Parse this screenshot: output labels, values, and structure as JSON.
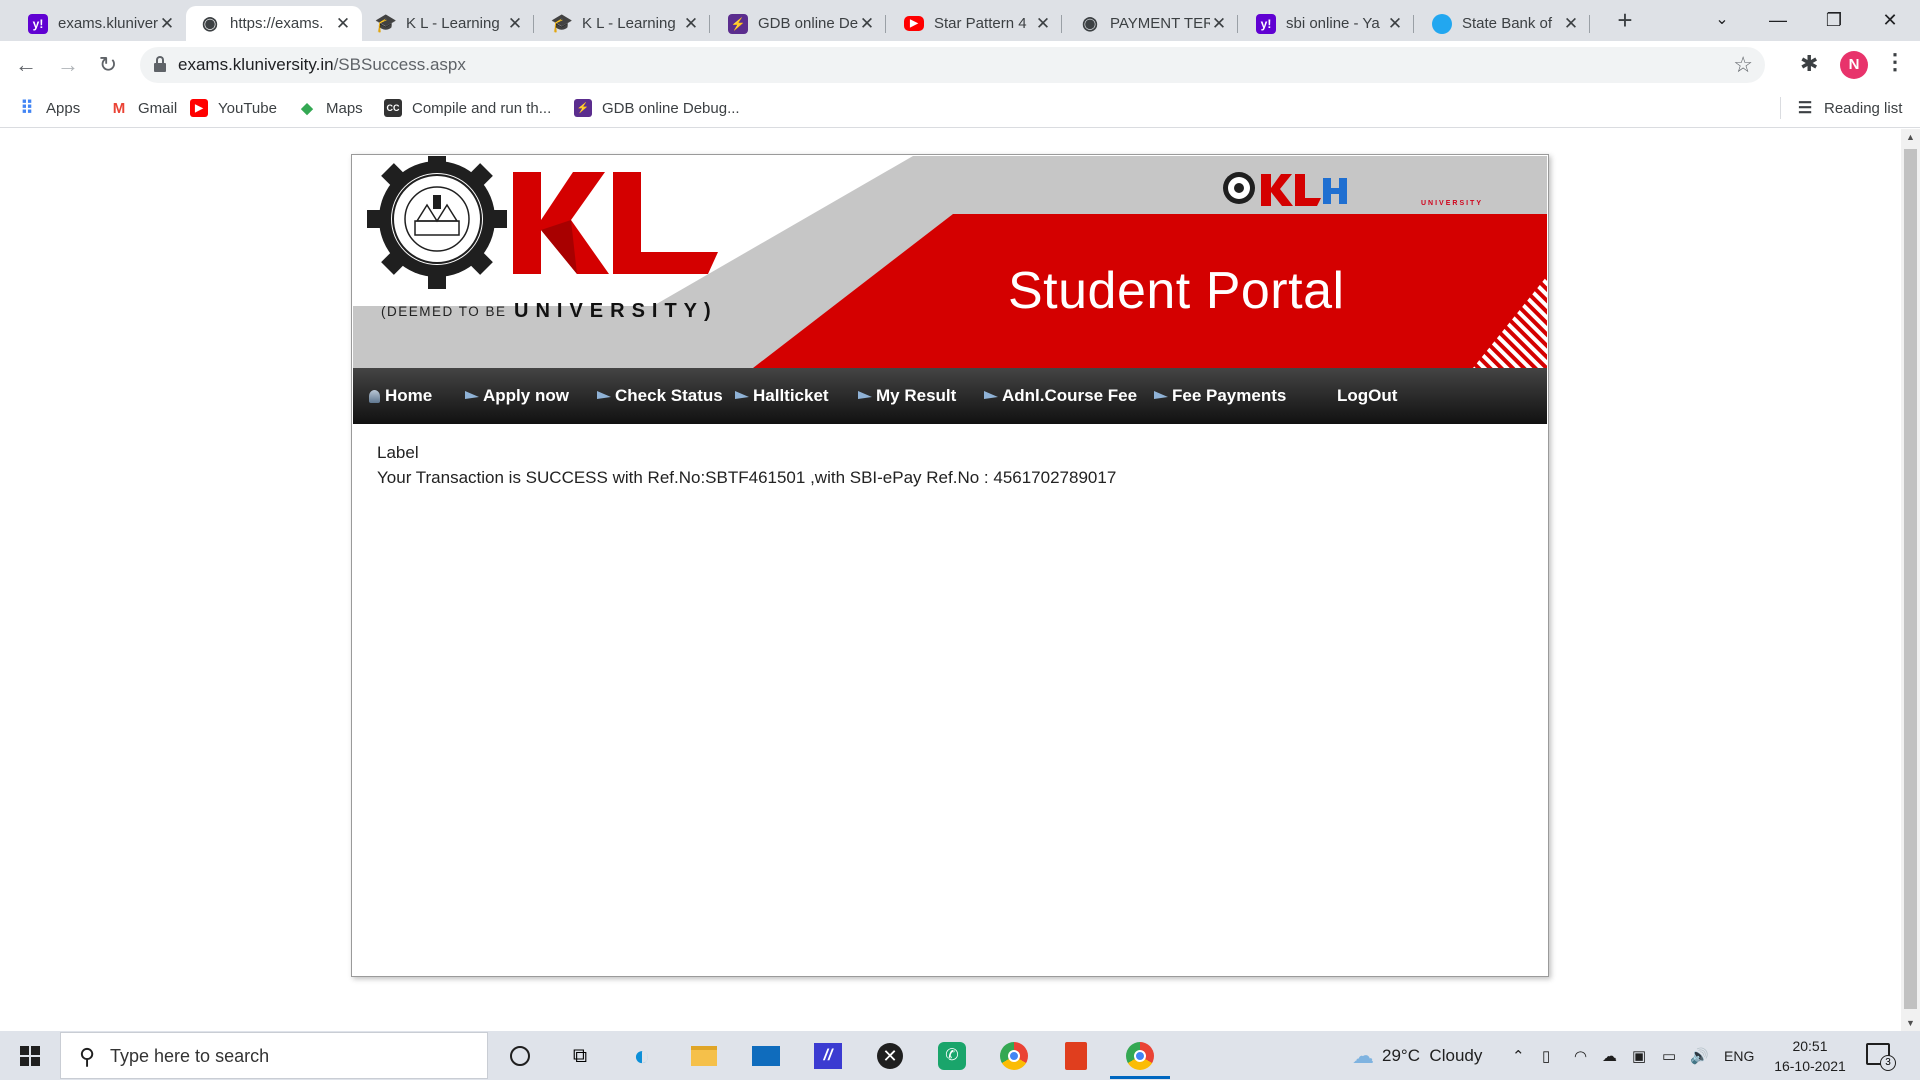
{
  "browser": {
    "tabs": [
      {
        "title": "exams.kluniver",
        "icon": "yahoo-icon",
        "color": "#6001d2",
        "glyph": "y!",
        "active": false
      },
      {
        "title": "https://exams.",
        "icon": "globe-icon",
        "color": "#3c4043",
        "glyph": "◉",
        "active": true
      },
      {
        "title": "K L - Learning",
        "icon": "klu-cap-icon",
        "color": "#e07a2e",
        "glyph": "🎓",
        "active": false
      },
      {
        "title": "K L - Learning",
        "icon": "klu-cap-icon",
        "color": "#e07a2e",
        "glyph": "🎓",
        "active": false
      },
      {
        "title": "GDB online De",
        "icon": "gdb-icon",
        "color": "#5b2d8e",
        "glyph": "⚡",
        "active": false
      },
      {
        "title": "Star Pattern 4",
        "icon": "youtube-icon",
        "color": "#ff0000",
        "glyph": "▶",
        "active": false
      },
      {
        "title": "PAYMENT TER",
        "icon": "globe-icon",
        "color": "#3c4043",
        "glyph": "◉",
        "active": false
      },
      {
        "title": "sbi online - Ya",
        "icon": "yahoo-icon",
        "color": "#6001d2",
        "glyph": "y!",
        "active": false
      },
      {
        "title": "State Bank of",
        "icon": "sbi-icon",
        "color": "#22a7f0",
        "glyph": "●",
        "active": false
      }
    ],
    "url_host": "exams.kluniversity.in",
    "url_path": "/SBSuccess.aspx",
    "bookmarks": [
      {
        "label": "Apps",
        "icon": "apps-grid-icon",
        "color": "#4285f4",
        "glyph": "⠿"
      },
      {
        "label": "Gmail",
        "icon": "gmail-icon",
        "color": "#ea4335",
        "glyph": "M"
      },
      {
        "label": "YouTube",
        "icon": "youtube-icon",
        "color": "#ff0000",
        "glyph": "▶"
      },
      {
        "label": "Maps",
        "icon": "maps-icon",
        "color": "#34a853",
        "glyph": "◆"
      },
      {
        "label": "Compile and run th...",
        "icon": "cc-icon",
        "color": "#333333",
        "glyph": "CC"
      },
      {
        "label": "GDB online Debug...",
        "icon": "gdb-icon",
        "color": "#5b2d8e",
        "glyph": "⚡"
      }
    ],
    "reading_list": "Reading list",
    "avatar_letter": "N"
  },
  "portal": {
    "title": "Student Portal",
    "deemed": "(DEEMED TO BE",
    "university": "UNIVERSITY)",
    "klh_sub": "UNIVERSITY",
    "menu": [
      {
        "label": "Home",
        "icon": "house-icon"
      },
      {
        "label": "Apply now",
        "icon": "arrow-icon"
      },
      {
        "label": "Check Status",
        "icon": "arrow-icon"
      },
      {
        "label": "Hallticket",
        "icon": "arrow-icon"
      },
      {
        "label": "My Result",
        "icon": "arrow-icon"
      },
      {
        "label": "Adnl.Course Fee",
        "icon": "arrow-icon"
      },
      {
        "label": "Fee Payments",
        "icon": "arrow-icon"
      },
      {
        "label": "LogOut",
        "icon": ""
      }
    ],
    "label_text": "Label",
    "message": "Your Transaction is SUCCESS with Ref.No:SBTF461501 ,with SBI-ePay Ref.No : 4561702789017"
  },
  "taskbar": {
    "search_placeholder": "Type here to search",
    "weather": "29°C  Cloudy",
    "lang": "ENG",
    "time": "20:51",
    "date": "16-10-2021",
    "notif_count": "3"
  },
  "colors": {
    "brand_red": "#d40000",
    "banner_grey": "#c6c6c6"
  }
}
